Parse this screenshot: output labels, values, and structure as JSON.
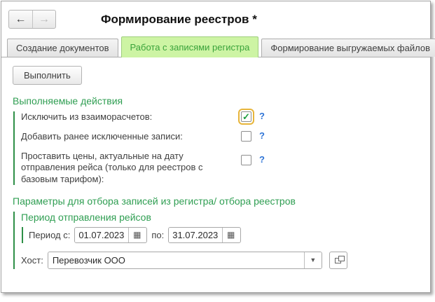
{
  "window": {
    "title": "Формирование реестров *"
  },
  "nav": {
    "back_glyph": "←",
    "forward_glyph": "→"
  },
  "tabs": [
    {
      "label": "Создание документов",
      "active": false
    },
    {
      "label": "Работа с записями регистра",
      "active": true
    },
    {
      "label": "Формирование выгружаемых файлов",
      "active": false
    }
  ],
  "toolbar": {
    "execute_label": "Выполнить"
  },
  "actions_group": {
    "title": "Выполняемые действия",
    "items": [
      {
        "label": "Исключить из взаиморасчетов:",
        "checked": true,
        "focused": true,
        "help": "?"
      },
      {
        "label": "Добавить ранее исключенные записи:",
        "checked": false,
        "focused": false,
        "help": "?"
      },
      {
        "label": "Проставить цены, актуальные на дату отправления рейса (только для реестров с  базовым тарифом):",
        "checked": false,
        "focused": false,
        "help": "?"
      }
    ]
  },
  "params_group": {
    "title": "Параметры для отбора записей из регистра/ отбора реестров",
    "period_group": {
      "title": "Период отправления рейсов",
      "from_label": "Период с:",
      "from_value": "01.07.2023",
      "to_label": "по:",
      "to_value": "31.07.2023"
    },
    "host": {
      "label": "Хост:",
      "value": "Перевозчик ООО"
    }
  },
  "icons": {
    "calendar_glyph": "▦",
    "dropdown_glyph": "▼"
  },
  "colors": {
    "accent": "#2f9e52",
    "accent-bar": "#2e8f47",
    "tab-active-bg": "#cdf4a4",
    "tab-active-text": "#3aa33a",
    "help": "#2e74d6",
    "focus-ring": "#e7b53b",
    "check": "#1b9e3e"
  }
}
